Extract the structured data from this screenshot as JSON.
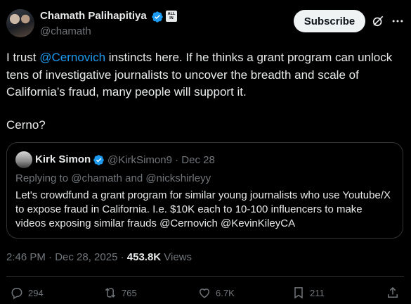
{
  "author": {
    "name": "Chamath Palihapitiya",
    "handle": "@chamath",
    "badge_text": "ALL\nIN"
  },
  "header": {
    "subscribe_label": "Subscribe"
  },
  "post": {
    "text_before": "I trust ",
    "mention": "@Cernovich",
    "text_after": " instincts here. If he thinks a grant program can unlock tens of investigative journalists to uncover the breadth and scale of California’s fraud, many people will support it.",
    "text2": "Cerno?"
  },
  "quote": {
    "name": "Kirk Simon",
    "handle": "@KirkSimon9",
    "date": "Dec 28",
    "reply_line": "Replying to @chamath and @nickshirleyy",
    "text": "Let's crowdfund a grant program for similar young journalists who use Youtube/X to expose fraud in California. I.e. $10K each to 10-100 influencers to make videos exposing similar frauds @Cernovich @KevinKileyCA"
  },
  "meta": {
    "time": "2:46 PM · Dec 28, 2025 · ",
    "views_count": "453.8K",
    "views_label": " Views"
  },
  "actions": {
    "replies": "294",
    "reposts": "765",
    "likes": "6.7K",
    "bookmarks": "211"
  },
  "colors": {
    "accent": "#1d9bf0",
    "background": "#000000",
    "muted": "#71767b"
  },
  "icons": [
    "verified-icon",
    "grok-icon",
    "more-icon",
    "reply-icon",
    "repost-icon",
    "like-icon",
    "bookmark-icon",
    "share-icon"
  ]
}
